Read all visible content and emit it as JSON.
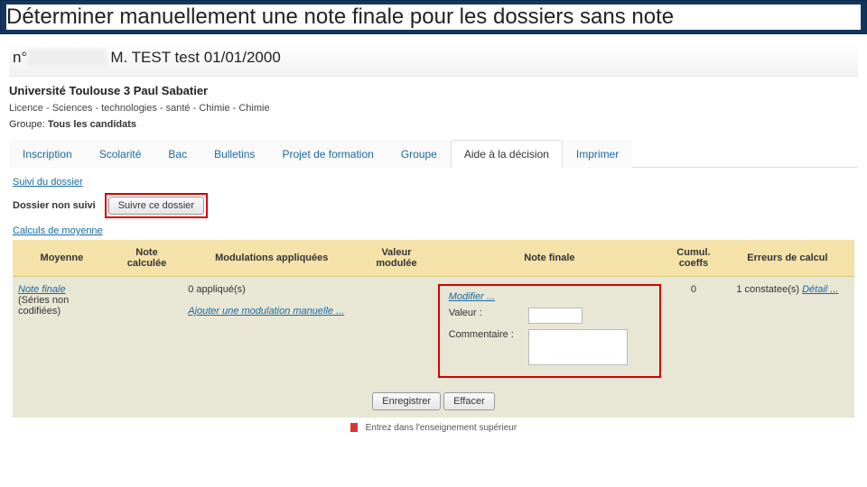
{
  "slide": {
    "title": "Déterminer manuellement une note finale pour les dossiers sans note"
  },
  "candidate": {
    "prefix": "n°",
    "hidden_id": "XXXXXXX",
    "name": "M. TEST test",
    "dob": "01/01/2000"
  },
  "university": "Université Toulouse 3 Paul Sabatier",
  "breadcrumbs": "Licence - Sciences - technologies - santé - Chimie - Chimie",
  "group": {
    "label": "Groupe:",
    "value": "Tous les candidats"
  },
  "tabs": [
    {
      "label": "Inscription"
    },
    {
      "label": "Scolarité"
    },
    {
      "label": "Bac"
    },
    {
      "label": "Bulletins"
    },
    {
      "label": "Projet de formation"
    },
    {
      "label": "Groupe"
    },
    {
      "label": "Aide à la décision"
    },
    {
      "label": "Imprimer"
    }
  ],
  "active_tab": 6,
  "suivi": {
    "section_label": "Suivi du dossier",
    "status": "Dossier non suivi",
    "follow_btn": "Suivre ce dossier"
  },
  "calculs": {
    "section_label": "Calculs de moyenne"
  },
  "table": {
    "headers": {
      "moyenne": "Moyenne",
      "note_calc": "Note calculée",
      "modulations": "Modulations appliquées",
      "valeur_mod": "Valeur modulée",
      "note_finale": "Note finale",
      "cumul": "Cumul. coeffs",
      "erreurs": "Erreurs de calcul"
    },
    "row": {
      "moyenne_link": "Note finale",
      "moyenne_sub": "(Séries non codifiées)",
      "applique": "0 appliqué(s)",
      "ajouter_link": "Ajouter une modulation manuelle ...",
      "modifier_link": "Modifier ...",
      "valeur_label": "Valeur :",
      "commentaire_label": "Commentaire :",
      "cumul_val": "0",
      "erreurs_text": "1 constatee(s)",
      "erreurs_link": "Détail ..."
    }
  },
  "actions": {
    "save": "Enregistrer",
    "clear": "Effacer"
  },
  "footer": "Entrez dans l'enseignement supérieur"
}
